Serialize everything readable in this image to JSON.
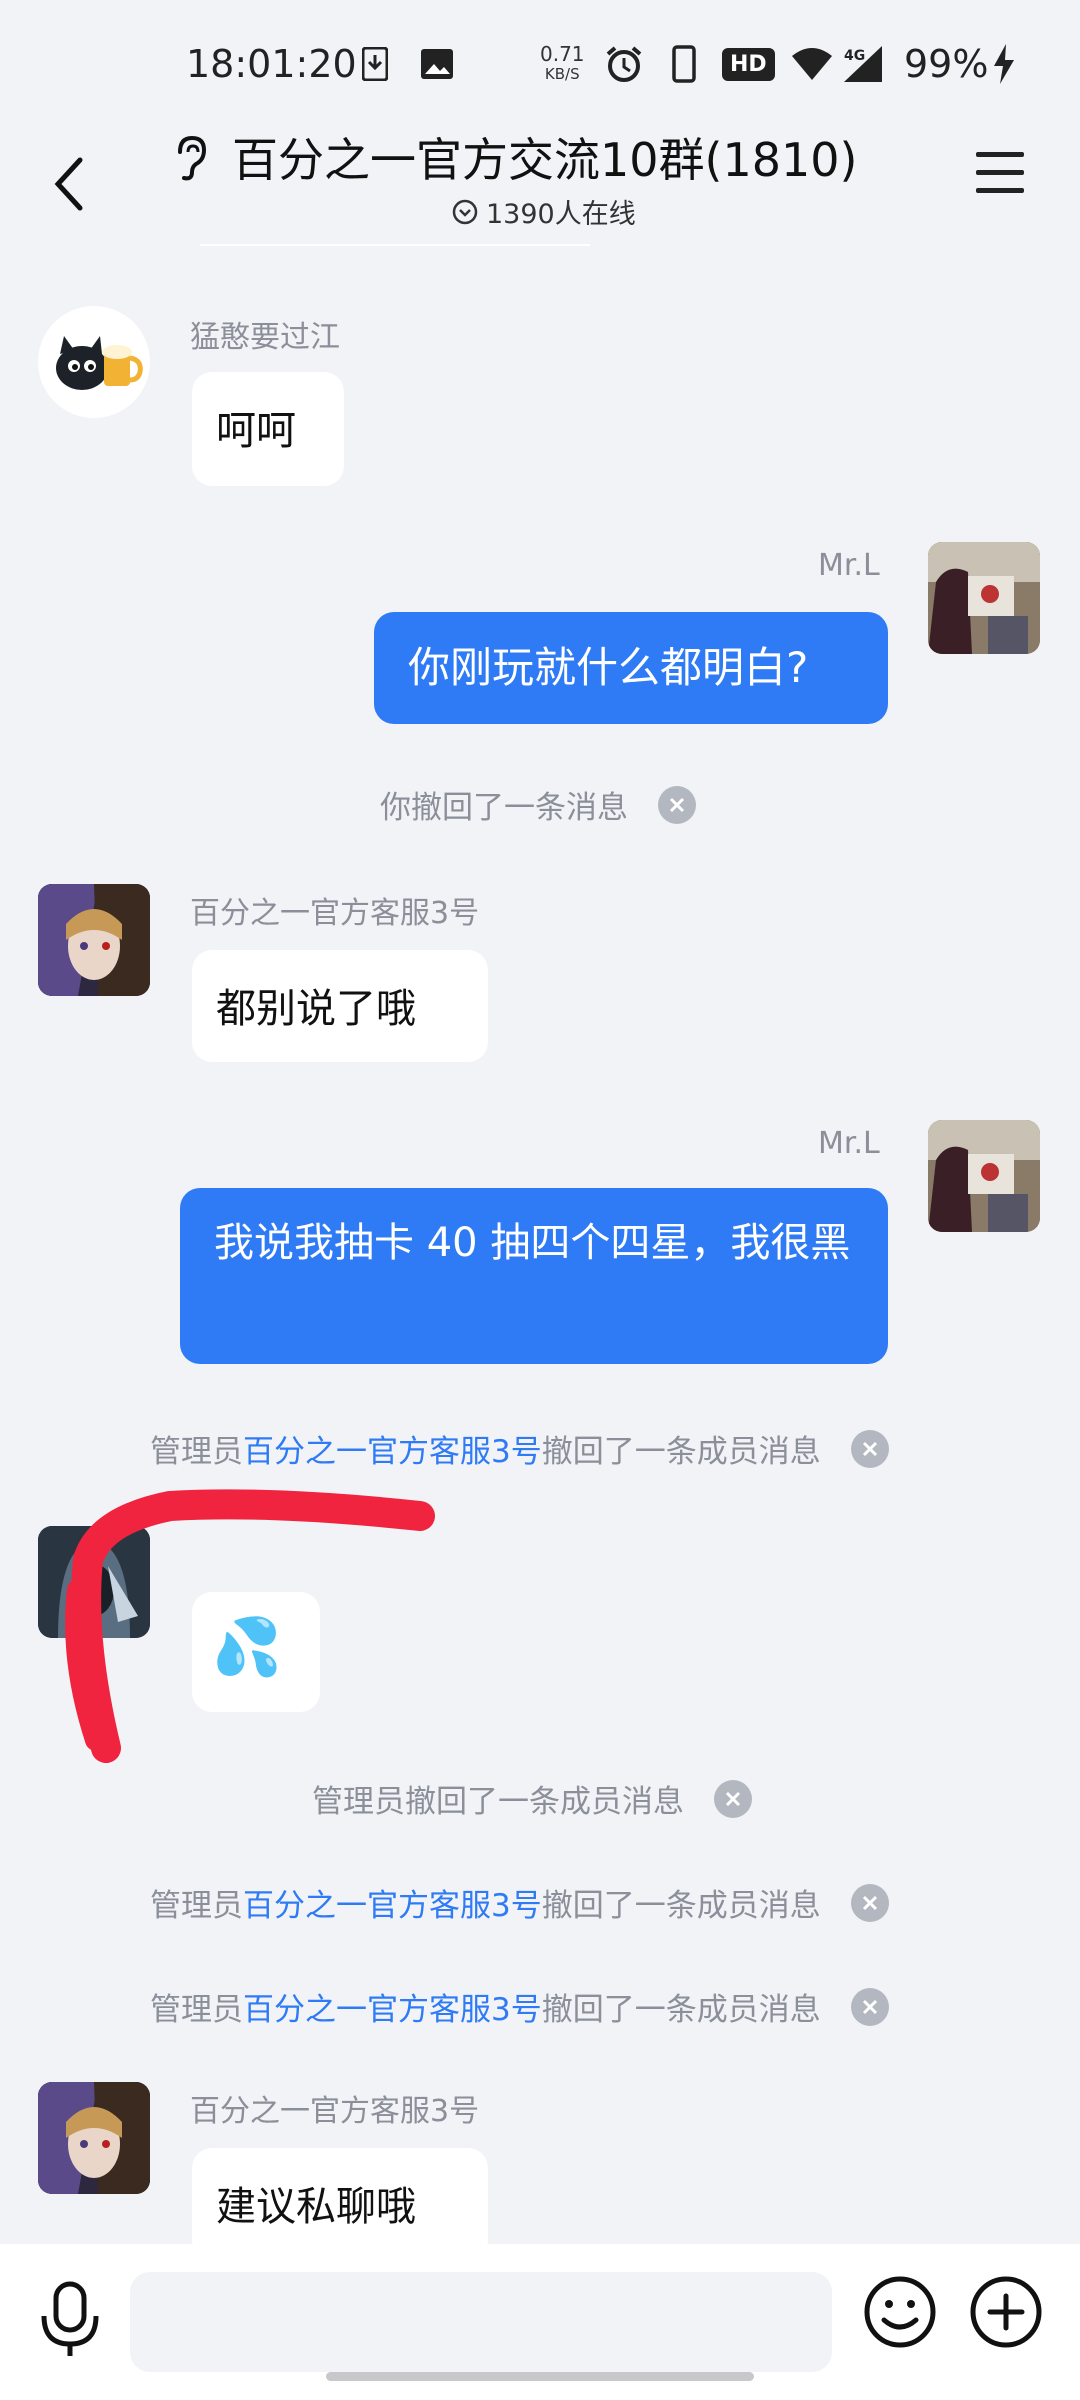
{
  "status_bar": {
    "time": "18:01:20",
    "net_speed_value": "0.71",
    "net_speed_unit": "KB/S",
    "hd_label": "HD",
    "signal_label": "4G",
    "battery": "99%"
  },
  "header": {
    "title": "百分之一官方交流10群(1810)",
    "online_count": "1390人在线"
  },
  "messages": [
    {
      "type": "left",
      "sender": "猛憨要过江",
      "text": "呵呵"
    },
    {
      "type": "right",
      "sender": "Mr.L",
      "text": "你刚玩就什么都明白?"
    },
    {
      "type": "notice",
      "text": "你撤回了一条消息"
    },
    {
      "type": "left",
      "sender": "百分之一官方客服3号",
      "text": "都别说了哦"
    },
    {
      "type": "right",
      "sender": "Mr.L",
      "text": "我说我抽卡 40 抽四个四星，我很黑"
    },
    {
      "type": "notice",
      "prefix": "管理员",
      "link": "百分之一官方客服3号",
      "suffix": "撤回了一条成员消息"
    },
    {
      "type": "left",
      "sender": "",
      "emoji": "💦"
    },
    {
      "type": "notice",
      "text": "管理员撤回了一条成员消息"
    },
    {
      "type": "notice",
      "prefix": "管理员",
      "link": "百分之一官方客服3号",
      "suffix": "撤回了一条成员消息"
    },
    {
      "type": "notice",
      "prefix": "管理员",
      "link": "百分之一官方客服3号",
      "suffix": "撤回了一条成员消息"
    },
    {
      "type": "left",
      "sender": "百分之一官方客服3号",
      "text": "建议私聊哦"
    }
  ],
  "input": {
    "placeholder": ""
  },
  "colors": {
    "accent": "#2f7bf6",
    "background": "#f2f3f7",
    "annotation": "#f0243f"
  }
}
